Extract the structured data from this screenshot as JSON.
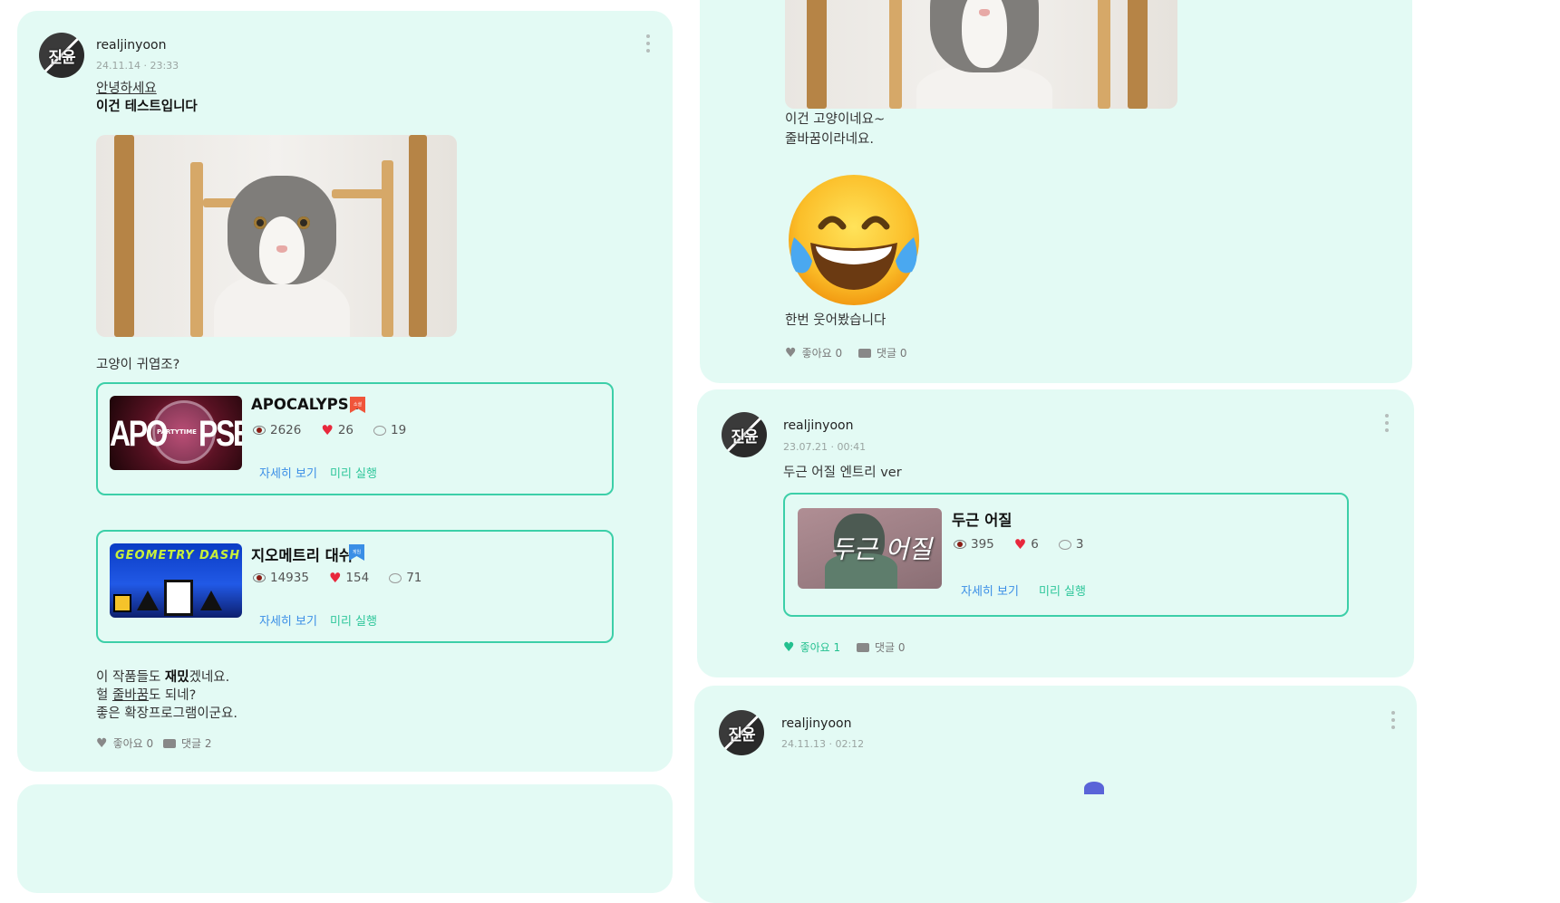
{
  "posts": [
    {
      "author": "realjinyoon",
      "avatar_text": "진윤",
      "date": "24.11.14 · 23:33",
      "line1": "안녕하세요",
      "line2": "이건 테스트입니다",
      "caption": "고양이 귀엽조?",
      "projects": [
        {
          "title": "APOCALYPSE",
          "thumb_text_left": "APO",
          "thumb_text_right": "PSE",
          "thumb_badge": "PARTYTIME",
          "tag_text": "소셜",
          "tag_color": "#f0553a",
          "views": "2626",
          "likes": "26",
          "comments": "19",
          "detail_link": "자세히 보기",
          "preview_link": "미리 실행"
        },
        {
          "title": "지오메트리 대쉬",
          "thumb_text": "GEOMETRY DASH",
          "tag_text": "게임",
          "tag_color": "#3a8ee6",
          "views": "14935",
          "likes": "154",
          "comments": "71",
          "detail_link": "자세히 보기",
          "preview_link": "미리 실행"
        }
      ],
      "after_1_pre": "이 작품들도 ",
      "after_1_bold": "재밌",
      "after_1_post": "겠네요.",
      "after_2_pre": "헐 ",
      "after_2_u": "줄바꿈",
      "after_2_post": "도 되네?",
      "after_3": "좋은 확장프로그램이군요.",
      "like_label": "좋아요 0",
      "comment_label": "댓글 2"
    },
    {
      "text1": "이건 고양이네요~",
      "text2": "줄바꿈이라네요.",
      "emoji_icon": "face-with-tears-of-joy-icon",
      "text3": "한번 웃어봤습니다",
      "like_label": "좋아요 0",
      "comment_label": "댓글 0"
    },
    {
      "author": "realjinyoon",
      "avatar_text": "진윤",
      "date": "23.07.21 · 00:41",
      "text": "두근 어질 엔트리 ver",
      "project": {
        "title": "두근 어질",
        "thumb_text": "두근 어질",
        "views": "395",
        "likes": "6",
        "comments": "3",
        "detail_link": "자세히 보기",
        "preview_link": "미리 실행"
      },
      "like_label": "좋아요 1",
      "comment_label": "댓글 0"
    },
    {
      "author": "realjinyoon",
      "avatar_text": "진윤",
      "date": "24.11.13 · 02:12"
    }
  ],
  "colors": {
    "card_bg": "#e3faf4",
    "accent": "#3ccfa8",
    "link_blue": "#3a8ee6",
    "link_green": "#2fc79b",
    "heart_red": "#e8283c"
  }
}
